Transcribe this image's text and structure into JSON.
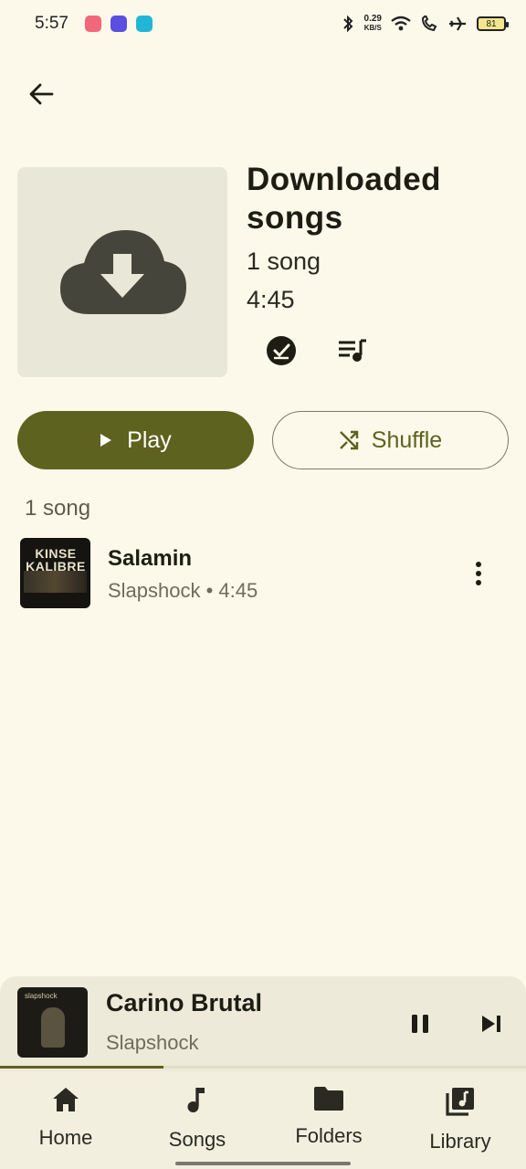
{
  "status_bar": {
    "time": "5:57",
    "net_speed_value": "0.29",
    "net_speed_unit": "KB/S",
    "battery": "81"
  },
  "header": {
    "title": "Downloaded songs",
    "song_count": "1 song",
    "duration": "4:45"
  },
  "actions": {
    "play_label": "Play",
    "shuffle_label": "Shuffle"
  },
  "list": {
    "section_count": "1 song",
    "songs": [
      {
        "title": "Salamin",
        "subtitle": "Slapshock • 4:45",
        "art_text": "KINSE KALIBRE"
      }
    ]
  },
  "mini_player": {
    "title": "Carino Brutal",
    "artist": "Slapshock",
    "progress": 0.31,
    "art_label": "slapshock"
  },
  "bottom_nav": {
    "items": [
      {
        "label": "Home",
        "icon": "home-icon"
      },
      {
        "label": "Songs",
        "icon": "music-note-icon"
      },
      {
        "label": "Folders",
        "icon": "folder-icon"
      },
      {
        "label": "Library",
        "icon": "library-music-icon"
      }
    ]
  },
  "colors": {
    "background": "#fcf9ea",
    "accent": "#5e621f",
    "surface": "#edead9"
  }
}
